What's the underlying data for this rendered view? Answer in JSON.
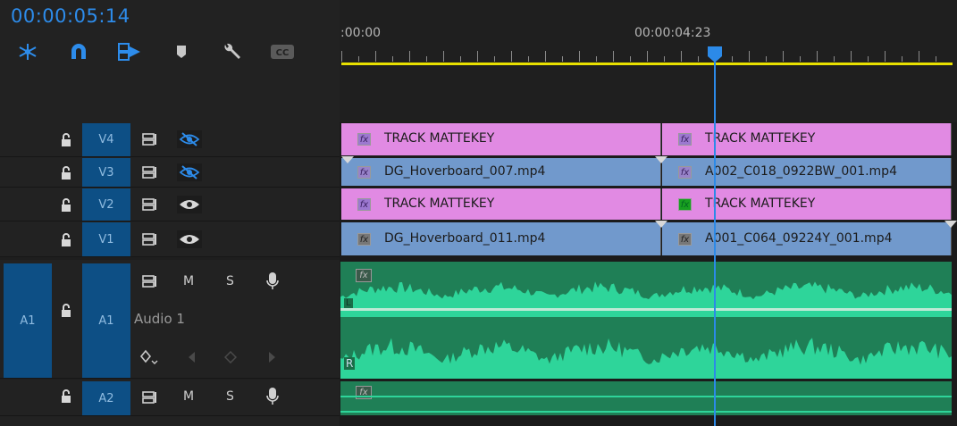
{
  "timecode": "00:00:05:14",
  "ruler": {
    "start_label": ":00:00",
    "playhead_label": "00:00:04:23"
  },
  "colors": {
    "accent": "#2d8ceb",
    "video_matte": "#e18ae3",
    "video_clip": "#7199cc",
    "audio": "#2ed59a",
    "work_area": "#e8e000"
  },
  "toolbar": [
    {
      "name": "nest-sequence-icon"
    },
    {
      "name": "snap-magnet-icon"
    },
    {
      "name": "linked-selection-icon"
    },
    {
      "name": "add-marker-icon"
    },
    {
      "name": "timeline-settings-wrench-icon"
    },
    {
      "name": "captions-cc-icon"
    }
  ],
  "video_tracks": [
    {
      "id": "V4",
      "visible": false,
      "clips": [
        {
          "label": "TRACK MATTEKEY",
          "kind": "matte",
          "fx": "fx"
        },
        {
          "label": "TRACK MATTEKEY",
          "kind": "matte",
          "fx": "fx"
        }
      ]
    },
    {
      "id": "V3",
      "visible": false,
      "clips": [
        {
          "label": "DG_Hoverboard_007.mp4",
          "kind": "video",
          "fx": "fx"
        },
        {
          "label": "A002_C018_0922BW_001.mp4",
          "kind": "video",
          "fx": "fx"
        }
      ]
    },
    {
      "id": "V2",
      "visible": true,
      "clips": [
        {
          "label": "TRACK MATTEKEY",
          "kind": "matte",
          "fx": "fx"
        },
        {
          "label": "TRACK MATTEKEY",
          "kind": "matte",
          "fx": "fx"
        }
      ]
    },
    {
      "id": "V1",
      "visible": true,
      "clips": [
        {
          "label": "DG_Hoverboard_011.mp4",
          "kind": "video",
          "fx": "fx"
        },
        {
          "label": "A001_C064_09224Y_001.mp4",
          "kind": "video",
          "fx": "fx"
        }
      ]
    }
  ],
  "audio_tracks": [
    {
      "id": "A1",
      "source_target": "A1",
      "name": "Audio 1",
      "mute": "M",
      "solo": "S",
      "channels": [
        "L",
        "R"
      ],
      "fx": "fx"
    },
    {
      "id": "A2",
      "mute": "M",
      "solo": "S",
      "fx": "fx"
    }
  ]
}
